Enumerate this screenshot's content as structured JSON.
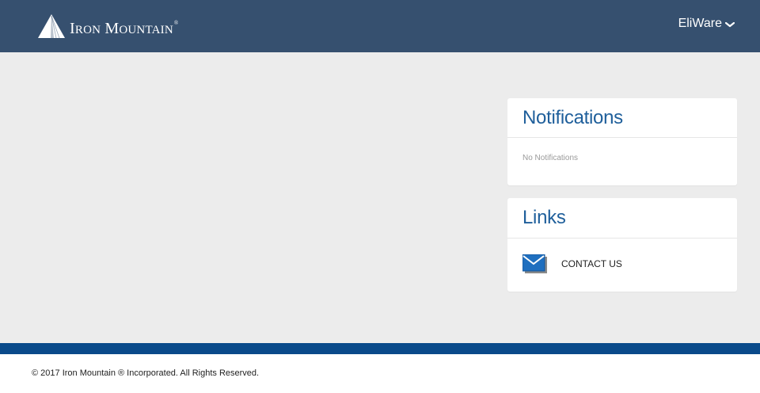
{
  "header": {
    "brand": {
      "name_first": "I",
      "name_first_rest": "RON",
      "name_second": "M",
      "name_second_rest": "OUNTAIN",
      "trademark": "®"
    },
    "user_name": "EliWare",
    "background_color": "#36506f"
  },
  "notifications": {
    "title": "Notifications",
    "empty_text": "No Notifications"
  },
  "links": {
    "title": "Links",
    "items": [
      {
        "label": "CONTACT US",
        "icon": "envelope-icon"
      }
    ]
  },
  "footer": {
    "copyright": "© 2017 Iron Mountain ® Incorporated. All Rights Reserved.",
    "bar_color": "#0a4a8a"
  }
}
